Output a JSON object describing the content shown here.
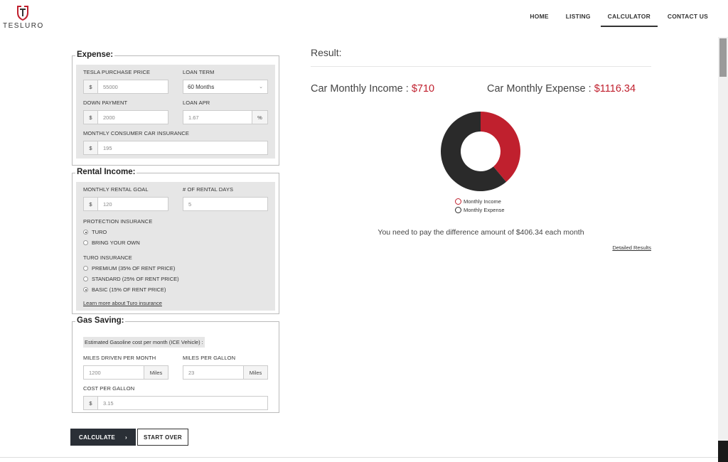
{
  "brand": {
    "name": "TESLURO",
    "accent": "#c0202e"
  },
  "nav": [
    "HOME",
    "LISTING",
    "CALCULATOR",
    "CONTACT US"
  ],
  "nav_active": "CALCULATOR",
  "expense": {
    "title": "Expense:",
    "purchase_price": {
      "label": "TESLA PURCHASE PRICE",
      "prefix": "$",
      "value": "55000"
    },
    "loan_term": {
      "label": "LOAN TERM",
      "value": "60 Months"
    },
    "down_payment": {
      "label": "DOWN PAYMENT",
      "prefix": "$",
      "value": "2000"
    },
    "loan_apr": {
      "label": "LOAN APR",
      "value": "1.67",
      "suffix": "%"
    },
    "insurance": {
      "label": "MONTHLY CONSUMER CAR INSURANCE",
      "prefix": "$",
      "value": "195"
    }
  },
  "rental": {
    "title": "Rental Income:",
    "goal": {
      "label": "MONTHLY RENTAL GOAL",
      "prefix": "$",
      "value": "120"
    },
    "days": {
      "label": "# OF RENTAL DAYS",
      "value": "5"
    },
    "protection_label": "PROTECTION INSURANCE",
    "protection_options": [
      {
        "label": "TURO",
        "checked": true
      },
      {
        "label": "BRING YOUR OWN",
        "checked": false
      }
    ],
    "turo_label": "TURO INSURANCE",
    "turo_options": [
      {
        "label": "PREMIUM (35% OF RENT PRICE)",
        "checked": false
      },
      {
        "label": "STANDARD (25% OF RENT PRICE)",
        "checked": false
      },
      {
        "label": "BASIC (15% OF RENT PRICE)",
        "checked": true
      }
    ],
    "learn_more": "Learn more about Turo insurance"
  },
  "gas": {
    "title": "Gas Saving:",
    "note": "Estimated Gasoline cost per month (ICE Vehicle) :",
    "miles": {
      "label": "MILES DRIVEN PER MONTH",
      "value": "1200",
      "suffix": "Miles"
    },
    "mpg": {
      "label": "MILES PER GALLON",
      "value": "23",
      "suffix": "Miles"
    },
    "cost": {
      "label": "COST PER GALLON",
      "prefix": "$",
      "value": "3.15"
    }
  },
  "buttons": {
    "calculate": "CALCULATE",
    "calculate_icon": "chevron-right-icon",
    "start_over": "START OVER"
  },
  "result": {
    "title": "Result:",
    "income_label": "Car Monthly Income : ",
    "income_value": "$710",
    "expense_label": "Car Monthly Expense : ",
    "expense_value": "$1116.34",
    "difference_text": "You need to pay the difference amount of $406.34 each month",
    "detail_link": "Detailed Results"
  },
  "chart_data": {
    "type": "pie",
    "donut": true,
    "series": [
      {
        "name": "Monthly Income",
        "value": 710,
        "color": "#c0202e"
      },
      {
        "name": "Monthly Expense",
        "value": 1116.34,
        "color": "#2a2a2a"
      }
    ],
    "legend": "bottom"
  }
}
